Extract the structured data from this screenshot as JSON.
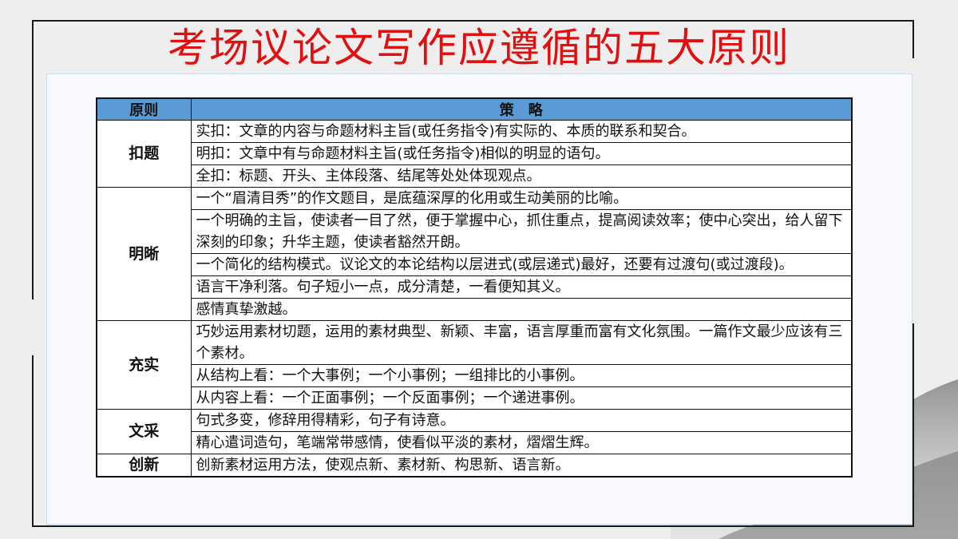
{
  "title": "考场议论文写作应遵循的五大原则",
  "table": {
    "headers": [
      "原则",
      "策　略"
    ],
    "groups": [
      {
        "principle": "扣题",
        "items": [
          "实扣：文章的内容与命题材料主旨(或任务指令)有实际的、本质的联系和契合。",
          "明扣：文章中有与命题材料主旨(或任务指令)相似的明显的语句。",
          "全扣：标题、开头、主体段落、结尾等处处体现观点。"
        ]
      },
      {
        "principle": "明晰",
        "items": [
          "一个“眉清目秀”的作文题目，是底蕴深厚的化用或生动美丽的比喻。",
          "一个明确的主旨，使读者一目了然，便于掌握中心，抓住重点，提高阅读效率；使中心突出，给人留下深刻的印象；升华主题，使读者豁然开朗。",
          "一个简化的结构模式。议论文的本论结构以层进式(或层递式)最好，还要有过渡句(或过渡段)。",
          "语言干净利落。句子短小一点，成分清楚，一看便知其义。",
          "感情真挚激越。"
        ]
      },
      {
        "principle": "充实",
        "items": [
          "巧妙运用素材切题，运用的素材典型、新颖、丰富，语言厚重而富有文化氛围。一篇作文最少应该有三个素材。",
          "从结构上看：一个大事例；一个小事例；一组排比的小事例。",
          "从内容上看：一个正面事例；一个反面事例；一个递进事例。"
        ]
      },
      {
        "principle": "文采",
        "items": [
          "句式多变，修辞用得精彩，句子有诗意。",
          "精心遣词造句，笔端常带感情，使看似平淡的素材，熠熠生辉。"
        ]
      },
      {
        "principle": "创新",
        "items": [
          "创新素材运用方法，使观点新、素材新、构思新、语言新。"
        ]
      }
    ]
  },
  "colors": {
    "title": "#e01010",
    "header_bg": "#5b9bd5"
  }
}
